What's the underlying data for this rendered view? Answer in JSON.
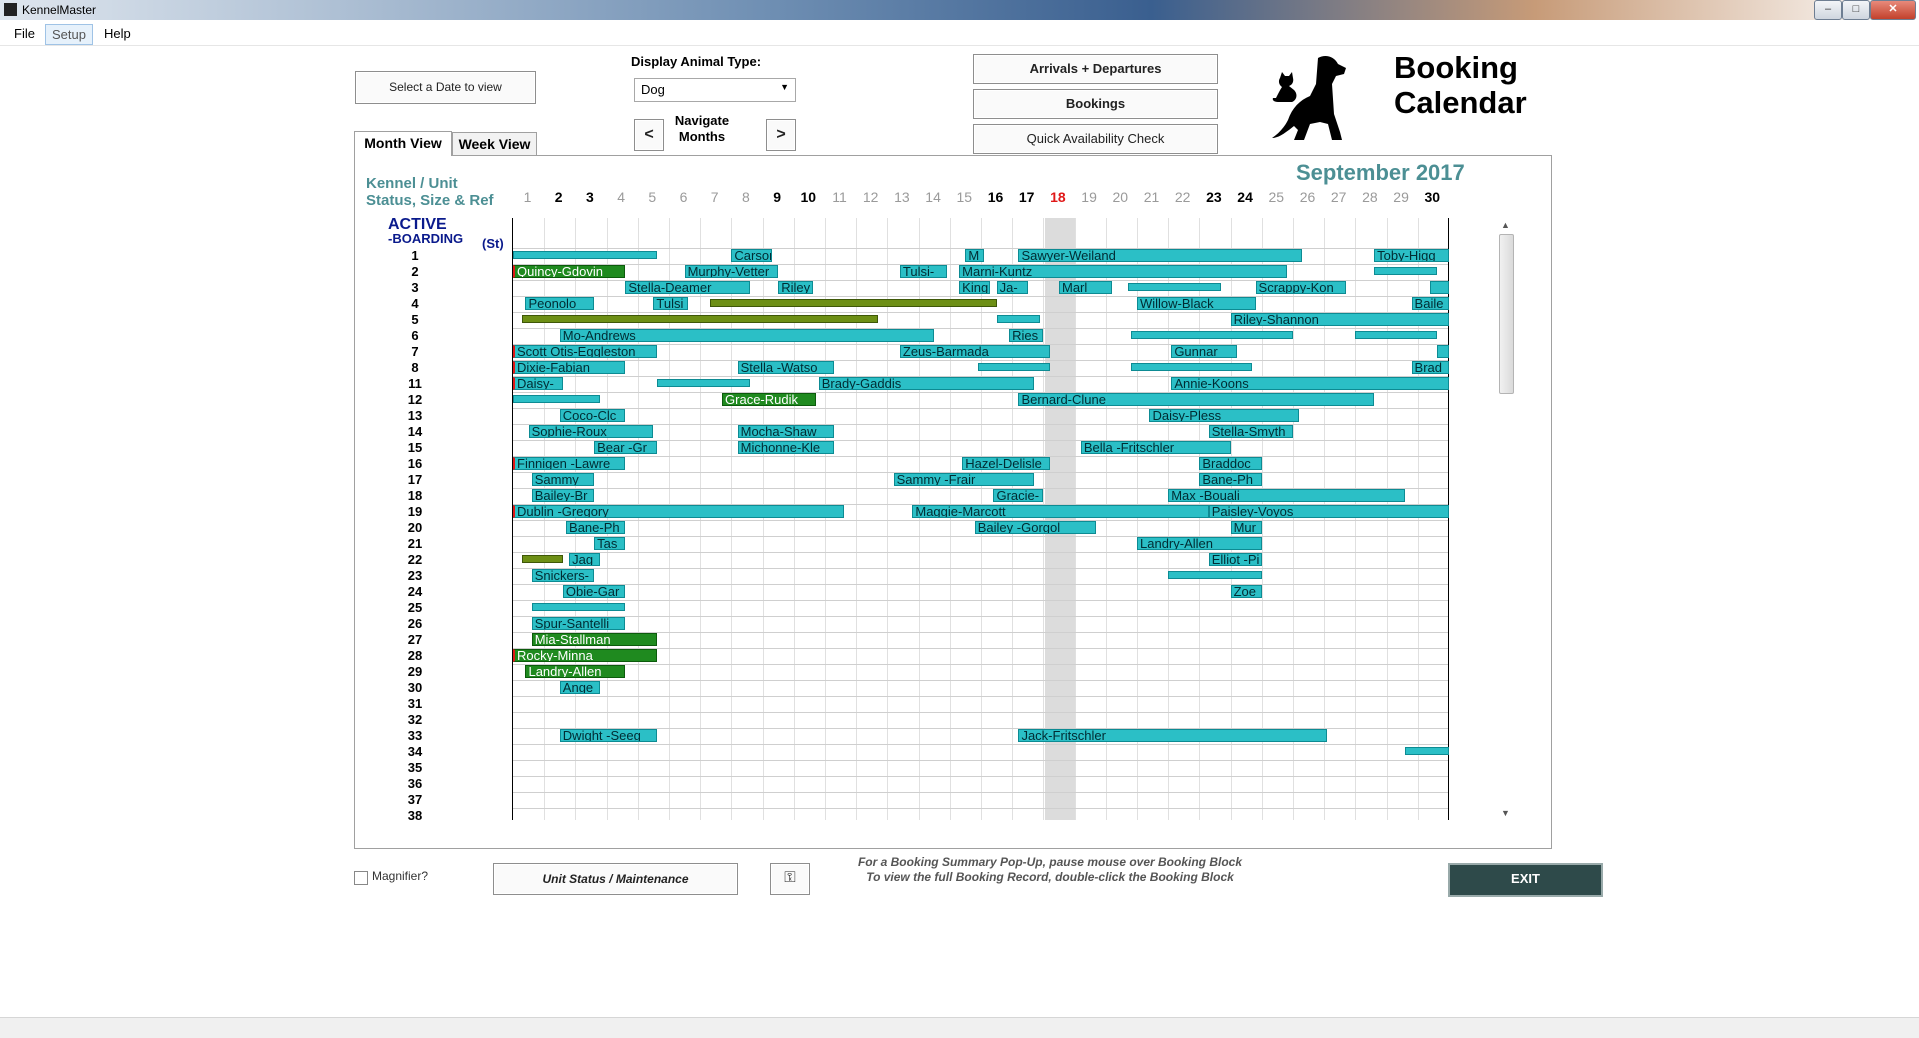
{
  "window": {
    "title": "KennelMaster"
  },
  "menu": [
    "File",
    "Setup",
    "Help"
  ],
  "controls": {
    "select_date": "Select a Date to view",
    "animal_type_label": "Display Animal Type:",
    "animal_type": "Dog",
    "navigate_label": "Navigate Months",
    "prev": "<",
    "next": ">",
    "arrivals": "Arrivals + Departures",
    "bookings": "Bookings",
    "availability": "Quick Availability Check",
    "title": "Booking Calendar"
  },
  "tabs": [
    "Month View",
    "Week View"
  ],
  "calendar": {
    "month": "September 2017",
    "header_line1": "Kennel / Unit",
    "header_line2": "Status, Size & Ref",
    "section": "ACTIVE",
    "section_sub": "-BOARDING",
    "section_status": "(St)",
    "today": 18,
    "days": [
      {
        "d": "1",
        "c": "#9a9a9a"
      },
      {
        "d": "2",
        "c": "#000"
      },
      {
        "d": "3",
        "c": "#000"
      },
      {
        "d": "4",
        "c": "#9a9a9a"
      },
      {
        "d": "5",
        "c": "#9a9a9a"
      },
      {
        "d": "6",
        "c": "#9a9a9a"
      },
      {
        "d": "7",
        "c": "#9a9a9a"
      },
      {
        "d": "8",
        "c": "#9a9a9a"
      },
      {
        "d": "9",
        "c": "#000"
      },
      {
        "d": "10",
        "c": "#000"
      },
      {
        "d": "11",
        "c": "#9a9a9a"
      },
      {
        "d": "12",
        "c": "#9a9a9a"
      },
      {
        "d": "13",
        "c": "#9a9a9a"
      },
      {
        "d": "14",
        "c": "#9a9a9a"
      },
      {
        "d": "15",
        "c": "#9a9a9a"
      },
      {
        "d": "16",
        "c": "#000"
      },
      {
        "d": "17",
        "c": "#000"
      },
      {
        "d": "18",
        "c": "#e01818"
      },
      {
        "d": "19",
        "c": "#9a9a9a"
      },
      {
        "d": "20",
        "c": "#9a9a9a"
      },
      {
        "d": "21",
        "c": "#9a9a9a"
      },
      {
        "d": "22",
        "c": "#9a9a9a"
      },
      {
        "d": "23",
        "c": "#000"
      },
      {
        "d": "24",
        "c": "#000"
      },
      {
        "d": "25",
        "c": "#9a9a9a"
      },
      {
        "d": "26",
        "c": "#9a9a9a"
      },
      {
        "d": "27",
        "c": "#9a9a9a"
      },
      {
        "d": "28",
        "c": "#9a9a9a"
      },
      {
        "d": "29",
        "c": "#9a9a9a"
      },
      {
        "d": "30",
        "c": "#000"
      }
    ],
    "units": [
      "1",
      "2",
      "3",
      "4",
      "5",
      "6",
      "7",
      "8",
      "11",
      "12",
      "13",
      "14",
      "15",
      "16",
      "17",
      "18",
      "19",
      "20",
      "21",
      "22",
      "23",
      "24",
      "25",
      "26",
      "27",
      "28",
      "29",
      "30",
      "31",
      "32",
      "33",
      "34",
      "35",
      "36",
      "37",
      "38"
    ],
    "bookings": [
      {
        "row": 0,
        "s": 1,
        "e": 5.6,
        "label": "",
        "kind": "thin"
      },
      {
        "row": 0,
        "s": 8,
        "e": 9.3,
        "label": "Carson-"
      },
      {
        "row": 0,
        "s": 15.5,
        "e": 16.1,
        "label": "M"
      },
      {
        "row": 0,
        "s": 17.2,
        "e": 26.3,
        "label": "Sawyer-Weiland"
      },
      {
        "row": 0,
        "s": 28.6,
        "e": 31,
        "label": "Toby-Higg"
      },
      {
        "row": 1,
        "s": 1,
        "e": 4.6,
        "label": "Quincy-Gdovin",
        "kind": "green redleft"
      },
      {
        "row": 1,
        "s": 6.5,
        "e": 9.5,
        "label": "Murphy-Vetter"
      },
      {
        "row": 1,
        "s": 13.4,
        "e": 14.9,
        "label": "Tulsi-"
      },
      {
        "row": 1,
        "s": 15.3,
        "e": 25.8,
        "label": "Marni-Kuntz"
      },
      {
        "row": 1,
        "s": 28.6,
        "e": 30.6,
        "label": "",
        "kind": "thin"
      },
      {
        "row": 2,
        "s": 4.6,
        "e": 8.6,
        "label": "Stella-Deamer"
      },
      {
        "row": 2,
        "s": 9.5,
        "e": 10.6,
        "label": "Riley"
      },
      {
        "row": 2,
        "s": 15.3,
        "e": 16.3,
        "label": "King"
      },
      {
        "row": 2,
        "s": 16.5,
        "e": 17.5,
        "label": "Ja-"
      },
      {
        "row": 2,
        "s": 18.5,
        "e": 20.2,
        "label": "Marl"
      },
      {
        "row": 2,
        "s": 20.7,
        "e": 23.7,
        "label": "",
        "kind": "thin"
      },
      {
        "row": 2,
        "s": 24.8,
        "e": 27.7,
        "label": "Scrappy-Kon"
      },
      {
        "row": 2,
        "s": 30.4,
        "e": 31,
        "label": ""
      },
      {
        "row": 3,
        "s": 1.4,
        "e": 3.6,
        "label": "Peonolo"
      },
      {
        "row": 3,
        "s": 5.5,
        "e": 6.6,
        "label": "Tulsi"
      },
      {
        "row": 3,
        "s": 7.3,
        "e": 16.5,
        "label": "",
        "kind": "thin olive"
      },
      {
        "row": 3,
        "s": 21,
        "e": 24.8,
        "label": "Willow-Black"
      },
      {
        "row": 3,
        "s": 29.8,
        "e": 31,
        "label": "Baile"
      },
      {
        "row": 4,
        "s": 1.3,
        "e": 12.7,
        "label": "",
        "kind": "thin olive"
      },
      {
        "row": 4,
        "s": 16.5,
        "e": 17.9,
        "label": "",
        "kind": "thin"
      },
      {
        "row": 4,
        "s": 24,
        "e": 31,
        "label": "Riley-Shannon"
      },
      {
        "row": 5,
        "s": 2.5,
        "e": 14.5,
        "label": "Mo-Andrews"
      },
      {
        "row": 5,
        "s": 16.9,
        "e": 18,
        "label": "Ries"
      },
      {
        "row": 5,
        "s": 20.8,
        "e": 26,
        "label": "",
        "kind": "thin"
      },
      {
        "row": 5,
        "s": 28,
        "e": 30.6,
        "label": "",
        "kind": "thin"
      },
      {
        "row": 6,
        "s": 1,
        "e": 5.6,
        "label": "Scott Otis-Eggleston",
        "kind": "redleft"
      },
      {
        "row": 6,
        "s": 13.4,
        "e": 18.2,
        "label": "Zeus-Barmada"
      },
      {
        "row": 6,
        "s": 22.1,
        "e": 24.2,
        "label": "Gunnar"
      },
      {
        "row": 6,
        "s": 30.6,
        "e": 31,
        "label": ""
      },
      {
        "row": 7,
        "s": 1,
        "e": 4.6,
        "label": "Dixie-Fabian",
        "kind": "redleft"
      },
      {
        "row": 7,
        "s": 8.2,
        "e": 11.3,
        "label": "Stella -Watso"
      },
      {
        "row": 7,
        "s": 15.9,
        "e": 18.2,
        "label": "",
        "kind": "thin"
      },
      {
        "row": 7,
        "s": 20.8,
        "e": 24.7,
        "label": "",
        "kind": "thin"
      },
      {
        "row": 7,
        "s": 29.8,
        "e": 31,
        "label": "Brad"
      },
      {
        "row": 8,
        "s": 1,
        "e": 2.6,
        "label": "Daisy-",
        "kind": "redleft"
      },
      {
        "row": 8,
        "s": 5.6,
        "e": 8.6,
        "label": "",
        "kind": "thin"
      },
      {
        "row": 8,
        "s": 10.8,
        "e": 17.7,
        "label": "Brady-Gaddis"
      },
      {
        "row": 8,
        "s": 22.1,
        "e": 31,
        "label": "Annie-Koons"
      },
      {
        "row": 9,
        "s": 1,
        "e": 3.8,
        "label": "",
        "kind": "thin"
      },
      {
        "row": 9,
        "s": 7.7,
        "e": 10.7,
        "label": "Grace-Rudik",
        "kind": "green"
      },
      {
        "row": 9,
        "s": 17.2,
        "e": 28.6,
        "label": "Bernard-Clune"
      },
      {
        "row": 10,
        "s": 2.5,
        "e": 4.6,
        "label": "Coco-Clc"
      },
      {
        "row": 10,
        "s": 21.4,
        "e": 26.2,
        "label": "Daisy-Pless"
      },
      {
        "row": 11,
        "s": 1.5,
        "e": 5.5,
        "label": "Sophie-Roux"
      },
      {
        "row": 11,
        "s": 8.2,
        "e": 11.3,
        "label": "Mocha-Shaw"
      },
      {
        "row": 11,
        "s": 23.3,
        "e": 26,
        "label": "Stella-Smyth"
      },
      {
        "row": 12,
        "s": 3.6,
        "e": 5.6,
        "label": "Bear -Gr"
      },
      {
        "row": 12,
        "s": 8.2,
        "e": 11.3,
        "label": "Michonne-Kle"
      },
      {
        "row": 12,
        "s": 19.2,
        "e": 24,
        "label": "Bella -Fritschler"
      },
      {
        "row": 13,
        "s": 1,
        "e": 4.6,
        "label": "Finnigen -Lawre",
        "kind": "redleft"
      },
      {
        "row": 13,
        "s": 15.4,
        "e": 18.2,
        "label": "Hazel-Delisle"
      },
      {
        "row": 13,
        "s": 23,
        "e": 25,
        "label": "Braddoc"
      },
      {
        "row": 14,
        "s": 1.6,
        "e": 3.6,
        "label": "Sammy"
      },
      {
        "row": 14,
        "s": 13.2,
        "e": 17.7,
        "label": "Sammy -Frair"
      },
      {
        "row": 14,
        "s": 23,
        "e": 25,
        "label": "Bane-Ph"
      },
      {
        "row": 15,
        "s": 1.6,
        "e": 3.6,
        "label": "Bailey-Br"
      },
      {
        "row": 15,
        "s": 16.4,
        "e": 18,
        "label": "Gracie-"
      },
      {
        "row": 15,
        "s": 22,
        "e": 29.6,
        "label": "Max -Bouali"
      },
      {
        "row": 16,
        "s": 1,
        "e": 11.6,
        "label": "Dublin -Gregory",
        "kind": "redleft"
      },
      {
        "row": 16,
        "s": 13.8,
        "e": 23.3,
        "label": "Maggie-Marcott"
      },
      {
        "row": 16,
        "s": 23.3,
        "e": 31,
        "label": "Paisley-Voyos"
      },
      {
        "row": 17,
        "s": 2.7,
        "e": 4.6,
        "label": "Bane-Ph"
      },
      {
        "row": 17,
        "s": 15.8,
        "e": 19.7,
        "label": "Bailey -Gorgol"
      },
      {
        "row": 17,
        "s": 24,
        "e": 25,
        "label": "Mur"
      },
      {
        "row": 18,
        "s": 3.6,
        "e": 4.6,
        "label": "Tas"
      },
      {
        "row": 18,
        "s": 21,
        "e": 25,
        "label": "Landry-Allen"
      },
      {
        "row": 19,
        "s": 1.3,
        "e": 2.6,
        "label": "",
        "kind": "thin olive"
      },
      {
        "row": 19,
        "s": 2.8,
        "e": 3.8,
        "label": "Jag"
      },
      {
        "row": 19,
        "s": 23.3,
        "e": 25,
        "label": "Elliot -Pi"
      },
      {
        "row": 20,
        "s": 1.6,
        "e": 3.6,
        "label": "Snickers-"
      },
      {
        "row": 20,
        "s": 22,
        "e": 25,
        "label": "",
        "kind": "thin"
      },
      {
        "row": 21,
        "s": 2.6,
        "e": 4.6,
        "label": "Obie-Gar"
      },
      {
        "row": 21,
        "s": 24,
        "e": 25,
        "label": "Zoe"
      },
      {
        "row": 22,
        "s": 1.6,
        "e": 4.6,
        "label": "",
        "kind": "thin"
      },
      {
        "row": 23,
        "s": 1.6,
        "e": 4.6,
        "label": "Spur-Santelli"
      },
      {
        "row": 24,
        "s": 1.6,
        "e": 5.6,
        "label": "Mia-Stallman",
        "kind": "green"
      },
      {
        "row": 25,
        "s": 1,
        "e": 5.6,
        "label": "Rocky-Minna",
        "kind": "green redleft"
      },
      {
        "row": 26,
        "s": 1.4,
        "e": 4.6,
        "label": "Landry-Allen",
        "kind": "green"
      },
      {
        "row": 27,
        "s": 2.5,
        "e": 3.8,
        "label": "Ange"
      },
      {
        "row": 30,
        "s": 2.5,
        "e": 5.6,
        "label": "Dwight -Seeg"
      },
      {
        "row": 30,
        "s": 17.2,
        "e": 27.1,
        "label": "Jack-Fritschler"
      },
      {
        "row": 31,
        "s": 29.6,
        "e": 31,
        "label": "",
        "kind": "thin"
      }
    ]
  },
  "footer": {
    "magnifier": "Magnifier?",
    "unit_status": "Unit Status / Maintenance",
    "key_icon": "key-icon",
    "help_line1": "For a Booking Summary Pop-Up, pause mouse over Booking Block",
    "help_line2": "To view the full Booking Record, double-click the Booking Block",
    "exit": "EXIT"
  }
}
